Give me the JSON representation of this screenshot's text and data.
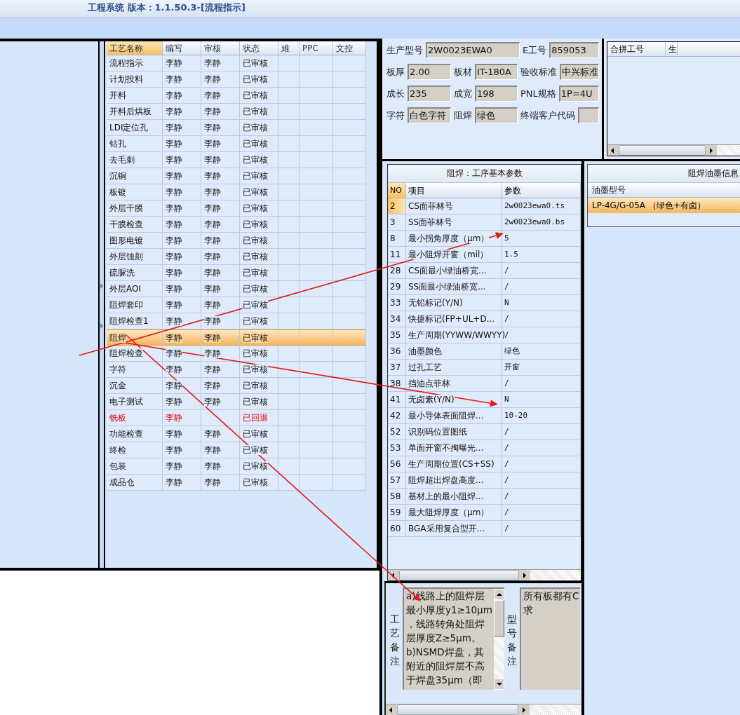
{
  "window": {
    "title": "工程系统 版本：1.1.50.3-[流程指示]"
  },
  "process_table": {
    "columns": [
      {
        "label": "工艺名称",
        "sorted": true
      },
      {
        "label": "编写",
        "sorted": false
      },
      {
        "label": "审核",
        "sorted": false
      },
      {
        "label": "状态",
        "sorted": false
      },
      {
        "label": "难",
        "sorted": false
      },
      {
        "label": "PPC",
        "sorted": false
      },
      {
        "label": "文控",
        "sorted": false
      }
    ],
    "rows": [
      {
        "name": "流程指示",
        "writer": "李静",
        "reviewer": "李静",
        "status": "已审核",
        "selected": false,
        "returned": false
      },
      {
        "name": "计划投料",
        "writer": "李静",
        "reviewer": "李静",
        "status": "已审核",
        "selected": false,
        "returned": false
      },
      {
        "name": "开料",
        "writer": "李静",
        "reviewer": "李静",
        "status": "已审核",
        "selected": false,
        "returned": false
      },
      {
        "name": "开料后烘板",
        "writer": "李静",
        "reviewer": "李静",
        "status": "已审核",
        "selected": false,
        "returned": false
      },
      {
        "name": "LDI定位孔",
        "writer": "李静",
        "reviewer": "李静",
        "status": "已审核",
        "selected": false,
        "returned": false
      },
      {
        "name": "钻孔",
        "writer": "李静",
        "reviewer": "李静",
        "status": "已审核",
        "selected": false,
        "returned": false
      },
      {
        "name": "去毛刺",
        "writer": "李静",
        "reviewer": "李静",
        "status": "已审核",
        "selected": false,
        "returned": false
      },
      {
        "name": "沉铜",
        "writer": "李静",
        "reviewer": "李静",
        "status": "已审核",
        "selected": false,
        "returned": false
      },
      {
        "name": "板镀",
        "writer": "李静",
        "reviewer": "李静",
        "status": "已审核",
        "selected": false,
        "returned": false
      },
      {
        "name": "外层干膜",
        "writer": "李静",
        "reviewer": "李静",
        "status": "已审核",
        "selected": false,
        "returned": false
      },
      {
        "name": "干膜检查",
        "writer": "李静",
        "reviewer": "李静",
        "status": "已审核",
        "selected": false,
        "returned": false
      },
      {
        "name": "图形电镀",
        "writer": "李静",
        "reviewer": "李静",
        "status": "已审核",
        "selected": false,
        "returned": false
      },
      {
        "name": "外层蚀刻",
        "writer": "李静",
        "reviewer": "李静",
        "status": "已审核",
        "selected": false,
        "returned": false
      },
      {
        "name": "硫脲洗",
        "writer": "李静",
        "reviewer": "李静",
        "status": "已审核",
        "selected": false,
        "returned": false
      },
      {
        "name": "外层AOI",
        "writer": "李静",
        "reviewer": "李静",
        "status": "已审核",
        "selected": false,
        "returned": false
      },
      {
        "name": "阻焊套印",
        "writer": "李静",
        "reviewer": "李静",
        "status": "已审核",
        "selected": false,
        "returned": false
      },
      {
        "name": "阻焊检查1",
        "writer": "李静",
        "reviewer": "李静",
        "status": "已审核",
        "selected": false,
        "returned": false
      },
      {
        "name": "阻焊",
        "writer": "李静",
        "reviewer": "李静",
        "status": "已审核",
        "selected": true,
        "returned": false
      },
      {
        "name": "阻焊检查",
        "writer": "李静",
        "reviewer": "李静",
        "status": "已审核",
        "selected": false,
        "returned": false
      },
      {
        "name": "字符",
        "writer": "李静",
        "reviewer": "李静",
        "status": "已审核",
        "selected": false,
        "returned": false
      },
      {
        "name": "沉金",
        "writer": "李静",
        "reviewer": "李静",
        "status": "已审核",
        "selected": false,
        "returned": false
      },
      {
        "name": "电子测试",
        "writer": "李静",
        "reviewer": "李静",
        "status": "已审核",
        "selected": false,
        "returned": false
      },
      {
        "name": "铣板",
        "writer": "李静",
        "status": "已回退",
        "selected": false,
        "returned": true
      },
      {
        "name": "功能检查",
        "writer": "李静",
        "reviewer": "李静",
        "status": "已审核",
        "selected": false,
        "returned": false
      },
      {
        "name": "终检",
        "writer": "李静",
        "reviewer": "李静",
        "status": "已审核",
        "selected": false,
        "returned": false
      },
      {
        "name": "包装",
        "writer": "李静",
        "reviewer": "李静",
        "status": "已审核",
        "selected": false,
        "returned": false
      },
      {
        "name": "成品仓",
        "writer": "李静",
        "reviewer": "李静",
        "status": "已审核",
        "selected": false,
        "returned": false
      }
    ]
  },
  "job_form": {
    "fields": [
      {
        "label": "生产型号",
        "value": "2W0023EWA0"
      },
      {
        "label": "E工号",
        "value": "859053"
      },
      {
        "label": "板厚",
        "value": "2.00"
      },
      {
        "label": "板材",
        "value": "IT-180A"
      },
      {
        "label": "验收标准",
        "value": "中兴标准"
      },
      {
        "label": "成长",
        "value": "235"
      },
      {
        "label": "成宽",
        "value": "198"
      },
      {
        "label": "PNL规格",
        "value": "1P=4U"
      },
      {
        "label": "字符",
        "value": "白色字符"
      },
      {
        "label": "阻焊",
        "value": "绿色"
      },
      {
        "label": "终端客户代码"
      }
    ]
  },
  "merge_grid": {
    "columns": [
      "合拼工号",
      "生"
    ]
  },
  "params_panel": {
    "title": "阻焊：工序基本参数",
    "columns": [
      "NO",
      "项目",
      "参数"
    ],
    "rows": [
      {
        "no": "2",
        "item": "CS面菲林号",
        "value": "2w0023ewa0.ts",
        "selected": true
      },
      {
        "no": "3",
        "item": "SS面菲林号",
        "value": "2w0023ewa0.bs",
        "selected": false
      },
      {
        "no": "8",
        "item": "最小拐角厚度（μm）",
        "value": "5",
        "selected": false
      },
      {
        "no": "11",
        "item": "最小阻焊开窗（mil）",
        "value": "1.5",
        "selected": false
      },
      {
        "no": "28",
        "item": "CS面最小绿油桥宽...",
        "value": "/",
        "selected": false
      },
      {
        "no": "29",
        "item": "SS面最小绿油桥宽...",
        "value": "/",
        "selected": false
      },
      {
        "no": "33",
        "item": "无铅标记(Y/N)",
        "value": "N",
        "selected": false
      },
      {
        "no": "34",
        "item": "快捷标记(FP+UL+D...",
        "value": "/",
        "selected": false
      },
      {
        "no": "35",
        "item": "生产周期(YYWW/WWYY)",
        "value": "/",
        "selected": false
      },
      {
        "no": "36",
        "item": "油墨颜色",
        "value": "绿色",
        "selected": false
      },
      {
        "no": "37",
        "item": "过孔工艺",
        "value": "开窗",
        "selected": false
      },
      {
        "no": "38",
        "item": "挡油点菲林",
        "value": "/",
        "selected": false
      },
      {
        "no": "41",
        "item": "无卤素(Y/N)",
        "value": "N",
        "selected": false
      },
      {
        "no": "42",
        "item": "最小导体表面阻焊...",
        "value": "10-20",
        "selected": false
      },
      {
        "no": "52",
        "item": "识别码位置图纸",
        "value": "/",
        "selected": false
      },
      {
        "no": "53",
        "item": "单面开窗不掏曝光...",
        "value": "/",
        "selected": false
      },
      {
        "no": "56",
        "item": "生产周期位置(CS+SS)",
        "value": "/",
        "selected": false
      },
      {
        "no": "57",
        "item": "阻焊超出焊盘高度...",
        "value": "/",
        "selected": false
      },
      {
        "no": "58",
        "item": "基材上的最小阻焊...",
        "value": "/",
        "selected": false
      },
      {
        "no": "59",
        "item": "最大阻焊厚度（μm）",
        "value": "/",
        "selected": false
      },
      {
        "no": "60",
        "item": "BGA采用复合型开...",
        "value": "/",
        "selected": false
      }
    ]
  },
  "ink_panel": {
    "title": "阻焊油墨信息",
    "columns": [
      "油墨型号"
    ],
    "rows": [
      {
        "model": "LP-4G/G-05A （绿色+有卤）",
        "selected": true
      }
    ]
  },
  "remarks": [
    {
      "label": "工艺备注",
      "lines": [
        "a)线路上的阻焊层",
        "最小厚度y1≥10μm",
        "，线路转角处阻焊",
        "层厚度Z≥5μm。",
        "b)NSMD焊盘，其",
        "附近的阻焊层不高",
        "于焊盘35μm（即"
      ],
      "scrollbar": true
    },
    {
      "label": "型号备注",
      "lines": [
        "所有板都有C",
        "求"
      ],
      "scrollbar": false
    }
  ]
}
